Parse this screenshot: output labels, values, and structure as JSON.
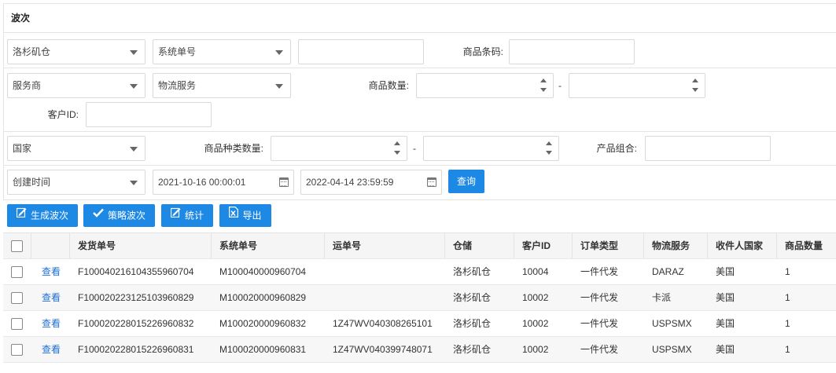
{
  "panel": {
    "title": "波次"
  },
  "filters": {
    "warehouse": "洛杉矶仓",
    "order_no_type": "系统单号",
    "order_no_value": "",
    "barcode_label": "商品条码:",
    "barcode_value": "",
    "provider": "服务商",
    "logistics": "物流服务",
    "qty_label": "商品数量:",
    "qty_from": "",
    "qty_to": "",
    "range_dash": "-",
    "customer_label": "客户ID:",
    "customer_value": "",
    "country": "国家",
    "kind_qty_label": "商品种类数量:",
    "kind_from": "",
    "kind_to": "",
    "combo_label": "产品组合:",
    "combo_value": "",
    "time_type": "创建时间",
    "date_from": "2021-10-16 00:00:01",
    "date_to": "2022-04-14 23:59:59",
    "query_label": "查询"
  },
  "toolbar": {
    "generate_label": "生成波次",
    "strategy_label": "策略波次",
    "stats_label": "统计",
    "export_label": "导出",
    "accent": "#1e88e5"
  },
  "table": {
    "columns": [
      "发货单号",
      "系统单号",
      "运单号",
      "仓储",
      "客户ID",
      "订单类型",
      "物流服务",
      "收件人国家",
      "商品数量"
    ],
    "action_label": "查看",
    "rows": [
      [
        "F100040216104355960704",
        "M100040000960704",
        "",
        "洛杉矶仓",
        "10004",
        "一件代发",
        "DARAZ",
        "美国",
        "1"
      ],
      [
        "F100020223125103960829",
        "M100020000960829",
        "",
        "洛杉矶仓",
        "10002",
        "一件代发",
        "卡派",
        "美国",
        "1"
      ],
      [
        "F100020228015226960832",
        "M100020000960832",
        "1Z47WV040308265101",
        "洛杉矶仓",
        "10002",
        "一件代发",
        "USPSMX",
        "美国",
        "1"
      ],
      [
        "F100020228015226960831",
        "M100020000960831",
        "1Z47WV040399748071",
        "洛杉矶仓",
        "10002",
        "一件代发",
        "USPSMX",
        "美国",
        "1"
      ]
    ]
  }
}
